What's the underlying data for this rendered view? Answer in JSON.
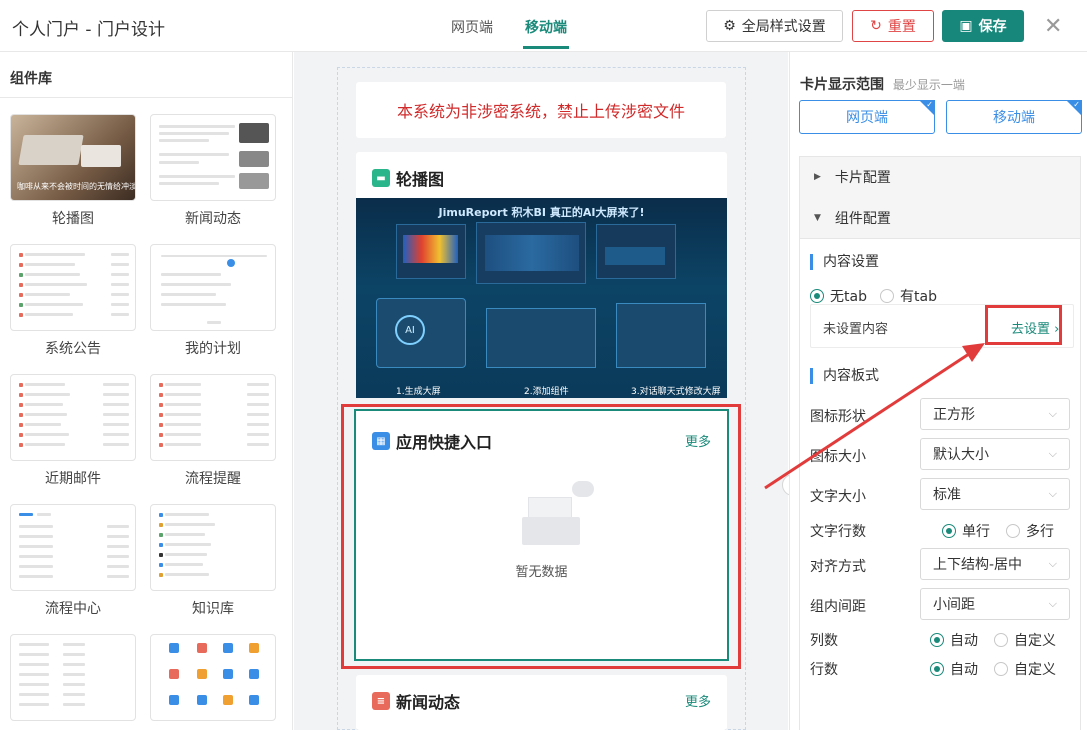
{
  "header": {
    "title": "个人门户 - 门户设计",
    "tabs": [
      {
        "label": "网页端",
        "active": false
      },
      {
        "label": "移动端",
        "active": true
      }
    ],
    "global_style_label": "全局样式设置",
    "reset_label": "重置",
    "save_label": "保存",
    "close_glyph": "✕"
  },
  "library": {
    "title": "组件库",
    "items": [
      {
        "label": "轮播图",
        "icon": "carousel-thumb"
      },
      {
        "label": "新闻动态",
        "icon": "news-thumb"
      },
      {
        "label": "系统公告",
        "icon": "notice-thumb"
      },
      {
        "label": "我的计划",
        "icon": "plan-thumb"
      },
      {
        "label": "近期邮件",
        "icon": "mail-thumb"
      },
      {
        "label": "流程提醒",
        "icon": "flow-remind-thumb"
      },
      {
        "label": "流程中心",
        "icon": "flow-center-thumb"
      },
      {
        "label": "知识库",
        "icon": "knowledge-thumb"
      }
    ],
    "carousel_caption": "咖啡从来不会被时间的无情给冲淡"
  },
  "canvas": {
    "warning": "本系统为非涉密系统，禁止上传涉密文件",
    "carousel": {
      "title": "轮播图",
      "banner_headline": "JimuReport 积木BI 真正的AI大屏来了!",
      "banner_steps": [
        "1.生成大屏",
        "2.添加组件",
        "3.对话聊天式修改大屏"
      ]
    },
    "quick_entry": {
      "title": "应用快捷入口",
      "more": "更多",
      "empty": "暂无数据"
    },
    "news": {
      "title": "新闻动态",
      "more": "更多"
    }
  },
  "props": {
    "scope_title": "卡片显示范围",
    "scope_hint": "最少显示一端",
    "scope_options": [
      {
        "label": "网页端",
        "checked": true
      },
      {
        "label": "移动端",
        "checked": true
      }
    ],
    "card_config": "卡片配置",
    "component_config": "组件配置",
    "content_section": "内容设置",
    "tab_options": [
      {
        "label": "无tab",
        "checked": true
      },
      {
        "label": "有tab",
        "checked": false
      }
    ],
    "no_content": "未设置内容",
    "go_set": "去设置",
    "layout_section": "内容板式",
    "icon_shape": {
      "label": "图标形状",
      "value": "正方形"
    },
    "icon_size": {
      "label": "图标大小",
      "value": "默认大小"
    },
    "text_size": {
      "label": "文字大小",
      "value": "标准"
    },
    "text_lines": {
      "label": "文字行数",
      "options": [
        {
          "label": "单行",
          "checked": true
        },
        {
          "label": "多行",
          "checked": false
        }
      ]
    },
    "align": {
      "label": "对齐方式",
      "value": "上下结构-居中"
    },
    "padding": {
      "label": "组内间距",
      "value": "小间距"
    },
    "columns": {
      "label": "列数",
      "options": [
        {
          "label": "自动",
          "checked": true
        },
        {
          "label": "自定义",
          "checked": false
        }
      ]
    },
    "rows": {
      "label": "行数",
      "options": [
        {
          "label": "自动",
          "checked": true
        },
        {
          "label": "自定义",
          "checked": false
        }
      ]
    }
  },
  "colors": {
    "accent": "#1a8a7a",
    "danger": "#e23b3b",
    "blue": "#3a8ee6"
  }
}
